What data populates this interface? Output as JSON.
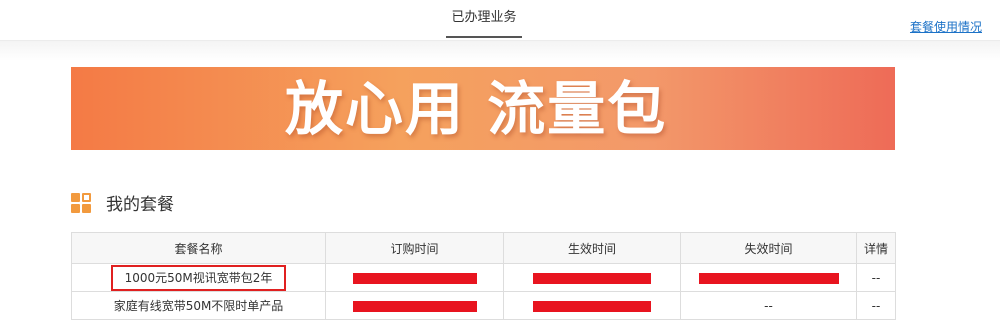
{
  "header": {
    "active_tab": "已办理业务",
    "usage_link": "套餐使用情况"
  },
  "banner": {
    "text": "放心用 流量包"
  },
  "section": {
    "title": "我的套餐"
  },
  "table": {
    "columns": [
      "套餐名称",
      "订购时间",
      "生效时间",
      "失效时间",
      "详情"
    ],
    "rows": [
      {
        "name": "1000元50M视讯宽带包2年",
        "order_time": "",
        "effective_time": "",
        "expire_time": "",
        "detail": "--"
      },
      {
        "name": "家庭有线宽带50M不限时单产品",
        "order_time": "",
        "effective_time": "",
        "expire_time": "--",
        "detail": "--"
      }
    ]
  },
  "colors": {
    "accent_link": "#1c72c7",
    "highlight_border": "#e02020",
    "redaction": "#e8141f",
    "section_icon": "#f29a3e"
  }
}
